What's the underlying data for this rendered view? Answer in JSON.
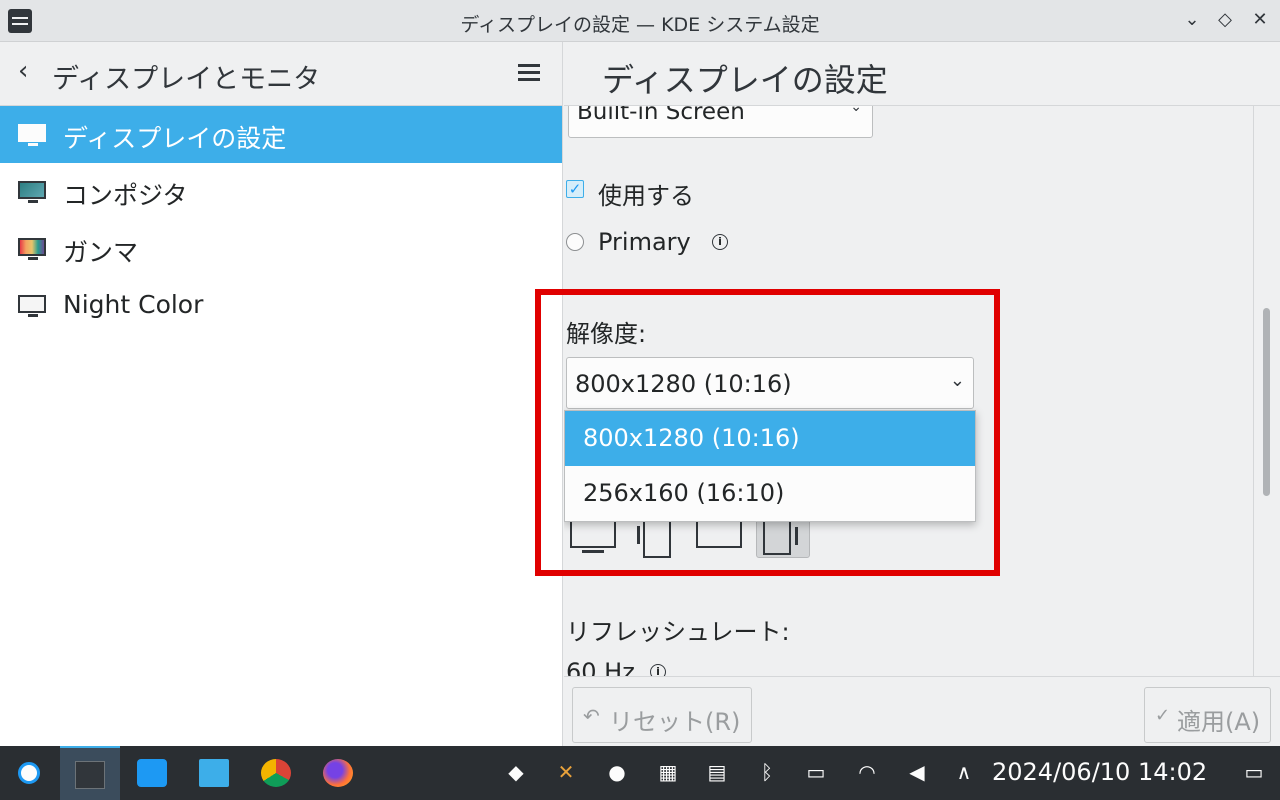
{
  "window": {
    "title": "ディスプレイの設定 — KDE システム設定",
    "buttons": {
      "minimize": "⌄",
      "maximize": "◇",
      "close": "✕"
    }
  },
  "sidebar": {
    "back_glyph": "‹",
    "title": "ディスプレイとモニタ",
    "items": [
      {
        "label": "ディスプレイの設定",
        "icon": "display-icon",
        "selected": true
      },
      {
        "label": "コンポジタ",
        "icon": "compositor-icon",
        "selected": false
      },
      {
        "label": "ガンマ",
        "icon": "gamma-icon",
        "selected": false
      },
      {
        "label": "Night Color",
        "icon": "night-color-icon",
        "selected": false
      }
    ]
  },
  "main": {
    "title": "ディスプレイの設定",
    "output_select": {
      "value": "Built-in Screen",
      "chevron": "⌄"
    },
    "enabled": {
      "label": "使用する",
      "checked": true,
      "glyph": "✓"
    },
    "primary": {
      "label": "Primary",
      "checked": false,
      "info": "i"
    },
    "resolution": {
      "label": "解像度:",
      "value": "800x1280 (10:16)",
      "chevron": "⌄",
      "options": [
        {
          "label": "800x1280 (10:16)",
          "highlighted": true
        },
        {
          "label": "256x160 (16:10)",
          "highlighted": false
        }
      ]
    },
    "orientation": {
      "options": [
        "landscape",
        "portrait",
        "landscape-flipped",
        "portrait-flipped"
      ],
      "selected": "portrait-flipped"
    },
    "refresh_rate": {
      "label": "リフレッシュレート:",
      "value": "60 Hz",
      "info": "i"
    }
  },
  "footer": {
    "reset": {
      "label": "リセット(R)",
      "glyph": "↶"
    },
    "apply": {
      "label": "適用(A)",
      "glyph": "✓"
    }
  },
  "taskbar": {
    "apps": [
      "launcher-icon",
      "system-settings-icon",
      "discover-icon",
      "file-manager-icon",
      "chrome-icon",
      "firefox-icon"
    ],
    "tray": [
      "dropbox-icon",
      "x-icon",
      "steam-icon",
      "keyboard-icon",
      "clipboard-icon",
      "bluetooth-icon",
      "display-icon",
      "wifi-icon",
      "volume-icon",
      "expand-icon"
    ],
    "clock": "2024/06/10  14:02"
  },
  "colors": {
    "accent": "#3daee9",
    "highlight_box": "#e00000",
    "taskbar": "#2a2e32"
  }
}
